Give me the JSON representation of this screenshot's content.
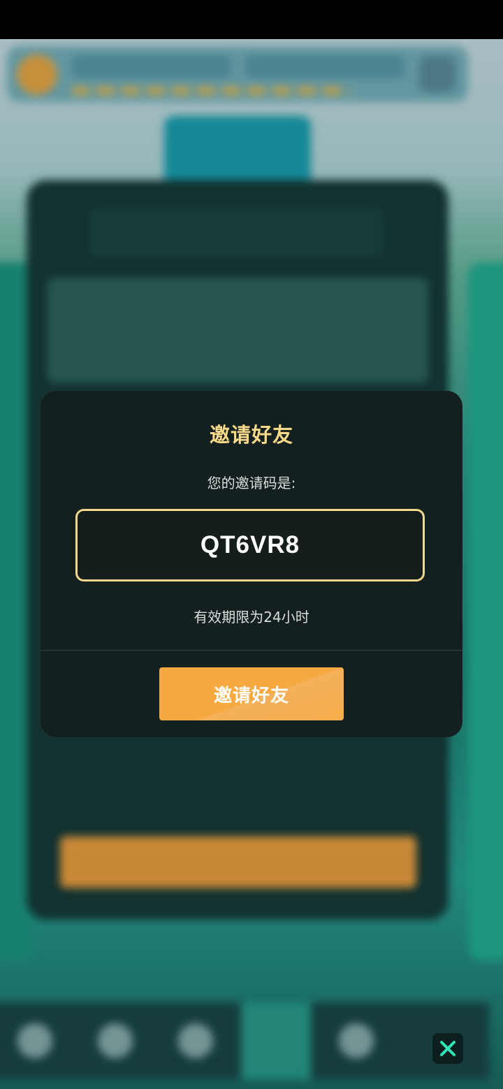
{
  "dialog": {
    "title": "邀请好友",
    "code_label": "您的邀请码是:",
    "invite_code": "QT6VR8",
    "expiry_text": "有效期限为24小时",
    "invite_button_label": "邀请好友"
  },
  "colors": {
    "dialog_bg": "#14201f",
    "title": "#f8d98a",
    "code_border": "#f5d98e",
    "button": "#f7a83f"
  },
  "icons": {
    "close": "close-x-icon"
  }
}
